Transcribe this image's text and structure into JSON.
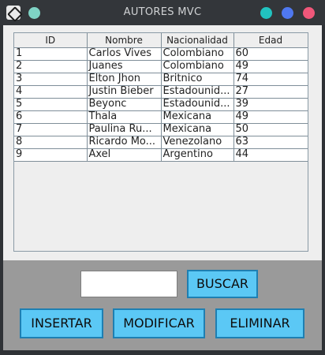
{
  "window": {
    "title": "AUTORES MVC"
  },
  "table": {
    "columns": [
      "ID",
      "Nombre",
      "Nacionalidad",
      "Edad"
    ],
    "rows": [
      [
        "1",
        "Carlos Vives",
        "Colombiano",
        "60"
      ],
      [
        "2",
        "Juanes",
        "Colombiano",
        "49"
      ],
      [
        "3",
        "Elton Jhon",
        "Britnico",
        "74"
      ],
      [
        "4",
        "Justin Bieber",
        "Estadounid...",
        "27"
      ],
      [
        "5",
        "Beyonc",
        "Estadounid...",
        "39"
      ],
      [
        "6",
        "Thala",
        "Mexicana",
        "49"
      ],
      [
        "7",
        "Paulina Ru...",
        "Mexicana",
        "50"
      ],
      [
        "8",
        "Ricardo Mo...",
        "Venezolano",
        "63"
      ],
      [
        "9",
        "Axel",
        "Argentino",
        "44"
      ]
    ]
  },
  "search": {
    "value": "",
    "button_label": "BUSCAR"
  },
  "actions": {
    "insert_label": "INSERTAR",
    "modify_label": "MODIFICAR",
    "delete_label": "ELIMINAR"
  },
  "colors": {
    "button_fill": "#5bc8f5",
    "button_border": "#1e7fb2",
    "bottom_panel": "#9a9a9a",
    "titlebar": "#33363a"
  }
}
